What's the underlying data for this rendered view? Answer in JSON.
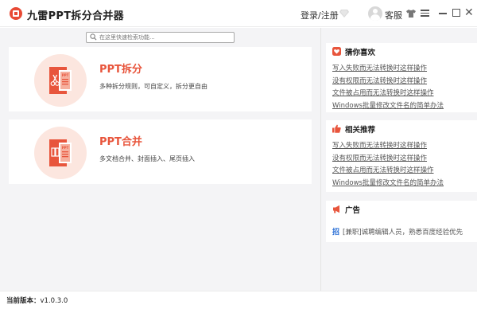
{
  "app": {
    "title": "九雷PPT拆分合并器",
    "login_label": "登录/注册",
    "service_label": "客服"
  },
  "search": {
    "placeholder": "在这里快速检索功能..."
  },
  "features": [
    {
      "title": "PPT拆分",
      "desc": "多种拆分规则，可自定义，拆分更自由",
      "icon": "ppt-split-icon"
    },
    {
      "title": "PPT合并",
      "desc": "多文档合并、封面插入、尾页插入",
      "icon": "ppt-merge-icon"
    }
  ],
  "sidebar": {
    "guess": {
      "title": "猜你喜欢",
      "icon": "heart-icon",
      "items": [
        "写入失败而无法转换时这样操作",
        "没有权限而无法转换时这样操作",
        "文件被占用而无法转换时这样操作",
        "Windows批量修改文件名的简单办法"
      ]
    },
    "recommend": {
      "title": "相关推荐",
      "icon": "thumbs-up-icon",
      "items": [
        "写入失败而无法转换时这样操作",
        "没有权限而无法转换时这样操作",
        "文件被占用而无法转换时这样操作",
        "Windows批量修改文件名的简单办法"
      ]
    },
    "ad": {
      "title": "广告",
      "icon": "megaphone-icon",
      "mark": "招",
      "text": "[兼职]诚聘编辑人员，熟悉百度经验优先"
    }
  },
  "status": {
    "version_label": "当前版本：",
    "version_value": "v1.0.3.0"
  },
  "colors": {
    "accent": "#e8553c",
    "accent_light": "#fce6df",
    "link_blue": "#2a6fd6"
  }
}
